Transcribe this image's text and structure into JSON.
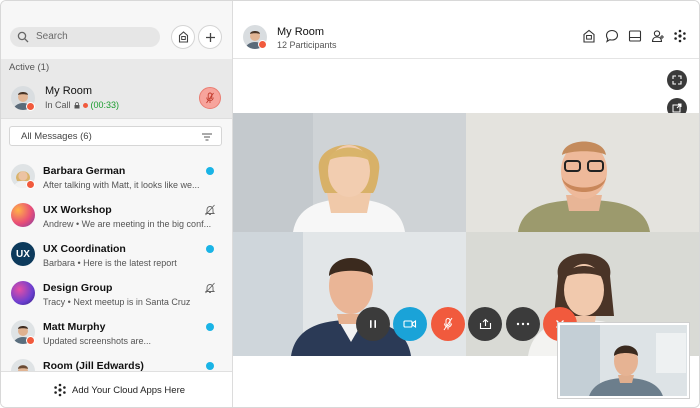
{
  "sidebar": {
    "search_placeholder": "Search",
    "active_header": "Active (1)",
    "active_room": {
      "title": "My Room",
      "status": "In Call",
      "duration": "(00:33)"
    },
    "filter_label": "All Messages (6)",
    "items": [
      {
        "name": "Barbara German",
        "preview": "After talking with Matt, it looks like we...",
        "indicator": "unread"
      },
      {
        "name": "UX Workshop",
        "preview": "Andrew • We are meeting in the big conf...",
        "indicator": "muted"
      },
      {
        "name": "UX Coordination",
        "preview": "Barbara • Here is the latest report",
        "indicator": "unread"
      },
      {
        "name": "Design Group",
        "preview": "Tracy • Next meetup is in Santa Cruz",
        "indicator": "muted"
      },
      {
        "name": "Matt Murphy",
        "preview": "Updated screenshots are...",
        "indicator": "unread"
      },
      {
        "name": "Room (Jill Edwards)",
        "preview": "",
        "indicator": "unread"
      }
    ],
    "footer_label": "Add Your Cloud Apps Here",
    "ux_avatar_text": "UX"
  },
  "main": {
    "title": "My Room",
    "participants": "12 Participants"
  },
  "colors": {
    "unread": "#1ab4e6",
    "mute_red": "#f15a3d",
    "video_blue": "#1aa3d8",
    "call_green": "#1a9d2e"
  },
  "icons": {
    "search": "search-icon",
    "room": "room-icon",
    "add": "plus-icon",
    "chat": "chat-bubble-icon",
    "meetings": "calendar-icon",
    "people": "person-icon",
    "apps": "asterisk-icon",
    "expand": "expand-icon",
    "popout": "popout-icon"
  }
}
